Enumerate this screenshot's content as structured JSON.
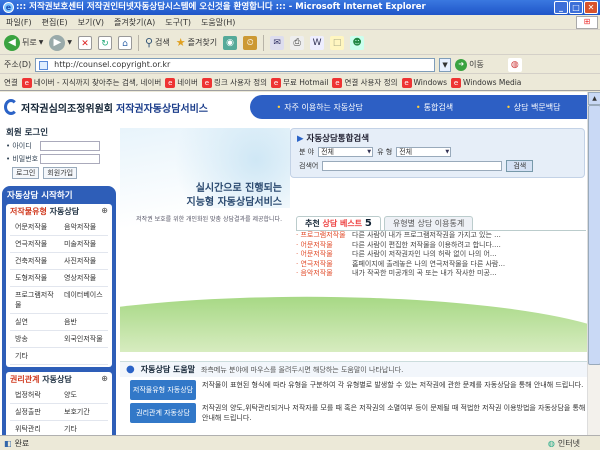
{
  "window": {
    "title": "::: 저작권보호센터 저작권인터넷자동상담시스템에 오신것을 환영합니다 ::: - Microsoft Internet Explorer",
    "controls": [
      "_",
      "□",
      "✕"
    ]
  },
  "menu": [
    "파일(F)",
    "편집(E)",
    "보기(V)",
    "즐겨찾기(A)",
    "도구(T)",
    "도움말(H)"
  ],
  "toolbar": {
    "back": "뒤로",
    "search": "검색",
    "favorites": "즐겨찾기"
  },
  "address": {
    "label": "주소(D)",
    "url": "http://counsel.copyright.or.kr",
    "go": "이동"
  },
  "links": {
    "label": "연결",
    "items": [
      "네이버 - 지식까지 찾아주는 검색, 네이버",
      "네이버",
      "링크 사용자 정의",
      "무료 Hotmail",
      "연결 사용자 정의",
      "Windows",
      "Windows Media"
    ]
  },
  "page": {
    "logo_main": "저작권심의조정위원회",
    "logo_sub": "저작권자동상담서비스",
    "topnav": [
      "자주 이용하는 자동상담",
      "통합검색",
      "상담 백문백답"
    ],
    "login": {
      "title": "회원 로그인",
      "id_label": "• 아이디",
      "pw_label": "• 비밀번호",
      "login_btn": "로그인",
      "join_btn": "회원가입"
    },
    "leftnav": {
      "title": "자동상담 시작하기",
      "works_title_red": "저작물유형",
      "works_title_rest": "자동상담",
      "works": [
        "어문저작물",
        "음악저작물",
        "연극저작물",
        "미술저작물",
        "건축저작물",
        "사진저작물",
        "도형저작물",
        "영상저작물",
        "프로그램저작물",
        "데이터베이스",
        "실연",
        "음반",
        "방송",
        "외국인저작물",
        "기타",
        ""
      ],
      "rights_title_red": "권리관계",
      "rights_title_rest": "자동상담",
      "rights": [
        "법정허락",
        "양도",
        "실정출판",
        "보호기간",
        "위탁관리",
        "기타"
      ]
    },
    "hero": {
      "line1": "실시간으로 진행되는",
      "line2": "지능형 자동상담서비스",
      "small": "저작권 보호를 위한 개인화된 맞춤 상담결과를 제공합니다."
    },
    "search": {
      "title": "자동상담통합검색",
      "field_label": "분 야",
      "field_value": "전체",
      "type_label": "유 형",
      "type_value": "전체",
      "keyword_label": "검색어",
      "button": "검색"
    },
    "tabs": {
      "active_prefix": "추천 ",
      "active_red": "상담 베스트",
      "active_num": "5",
      "inactive": "유형별 상담 이용통계"
    },
    "best": [
      {
        "cat": "· 프로그램저작물",
        "text": "다른 사람이 내가 프로그램저작권을 가지고 있는 ..."
      },
      {
        "cat": "· 어문저작물",
        "text": "다른 사람이 편집한 저작물을 이용하려고 합니다...."
      },
      {
        "cat": "· 어문저작물",
        "text": "다른 사람이 저작권자인 나의 허락 없이 나의 어..."
      },
      {
        "cat": "· 연극저작물",
        "text": "홈페이지에 출레놓은 나의 연극저작물을 다른 사람..."
      },
      {
        "cat": "· 음악저작물",
        "text": "내가 작곡한 미공개의 곡 또는 내가 작사한 미공..."
      }
    ],
    "help": {
      "title": "자동상담 도움말",
      "desc": "좌측메뉴 분야에 마우스를 올려두시면 해당하는 도움말이 나타납니다.",
      "rows": [
        {
          "label": "저작물유형 자동상담",
          "text": "저작물이 표현된 형식에 따라 유형을 구분하여 각 유형별로 발생할 수 있는 저작권에 관한 문제를 자동상담을 통해 안내해 드립니다."
        },
        {
          "label": "권리관계 자동상담",
          "text": "저작권의 양도,위탁관리되거나 저작자를 모를 때 혹은 저작권의 소멸여부 등이 문제될 때 적법한 저작권 이용방법을 자동상담을 통해 안내해 드립니다."
        }
      ]
    }
  },
  "status": {
    "left": "완료",
    "zone": "인터넷"
  }
}
